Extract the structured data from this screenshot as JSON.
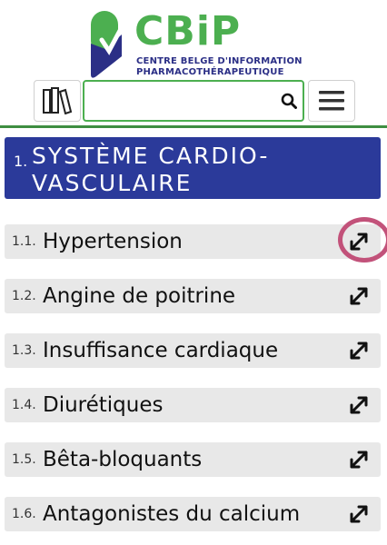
{
  "logo": {
    "wordmark": "CBiP",
    "subtitle_line1": "CENTRE BELGE D'INFORMATION",
    "subtitle_line2": "PHARMACOTHÉRAPEUTIQUE",
    "brand_green": "#4caf50",
    "brand_blue": "#2b2f86"
  },
  "toolbar": {
    "books_icon": "books-icon",
    "search": {
      "value": "",
      "placeholder": "",
      "icon": "search-icon"
    },
    "menu_icon": "hamburger-menu-icon"
  },
  "chapter": {
    "number": "1.",
    "title": "SYSTÈME CARDIO-VASCULAIRE",
    "color": "#2b3a9a"
  },
  "sections": [
    {
      "number": "1.1.",
      "label": "Hypertension"
    },
    {
      "number": "1.2.",
      "label": "Angine de poitrine"
    },
    {
      "number": "1.3.",
      "label": "Insuffisance cardiaque"
    },
    {
      "number": "1.4.",
      "label": "Diurétiques"
    },
    {
      "number": "1.5.",
      "label": "Bêta-bloquants"
    },
    {
      "number": "1.6.",
      "label": "Antagonistes du calcium"
    }
  ],
  "annotation_color": "#c2527a"
}
